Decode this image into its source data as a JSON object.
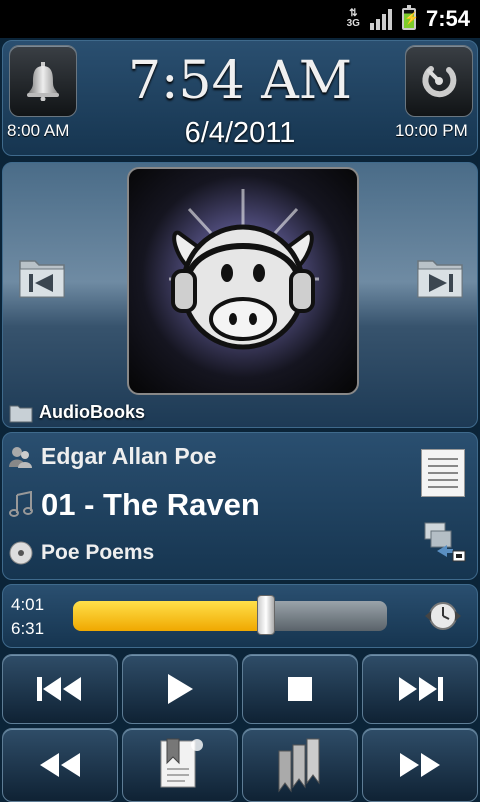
{
  "status_bar": {
    "network": "3G",
    "time": "7:54"
  },
  "clock": {
    "time": "7:54 AM",
    "date": "6/4/2011",
    "alarm_left": "8:00 AM",
    "alarm_right": "10:00 PM"
  },
  "library": {
    "folder": "AudioBooks"
  },
  "track": {
    "artist": "Edgar Allan Poe",
    "title": "01 - The Raven",
    "album": "Poe Poems"
  },
  "progress": {
    "elapsed": "4:01",
    "total": "6:31",
    "fraction": 0.616
  },
  "controls": {
    "row1": [
      "previous-track",
      "play",
      "stop",
      "next-track"
    ],
    "row2": [
      "rewind",
      "bookmark",
      "bookmarks",
      "fast-forward"
    ]
  },
  "colors": {
    "progress_fill": "#f0a800",
    "panel": "#1f4260",
    "background": "#0b2438"
  }
}
